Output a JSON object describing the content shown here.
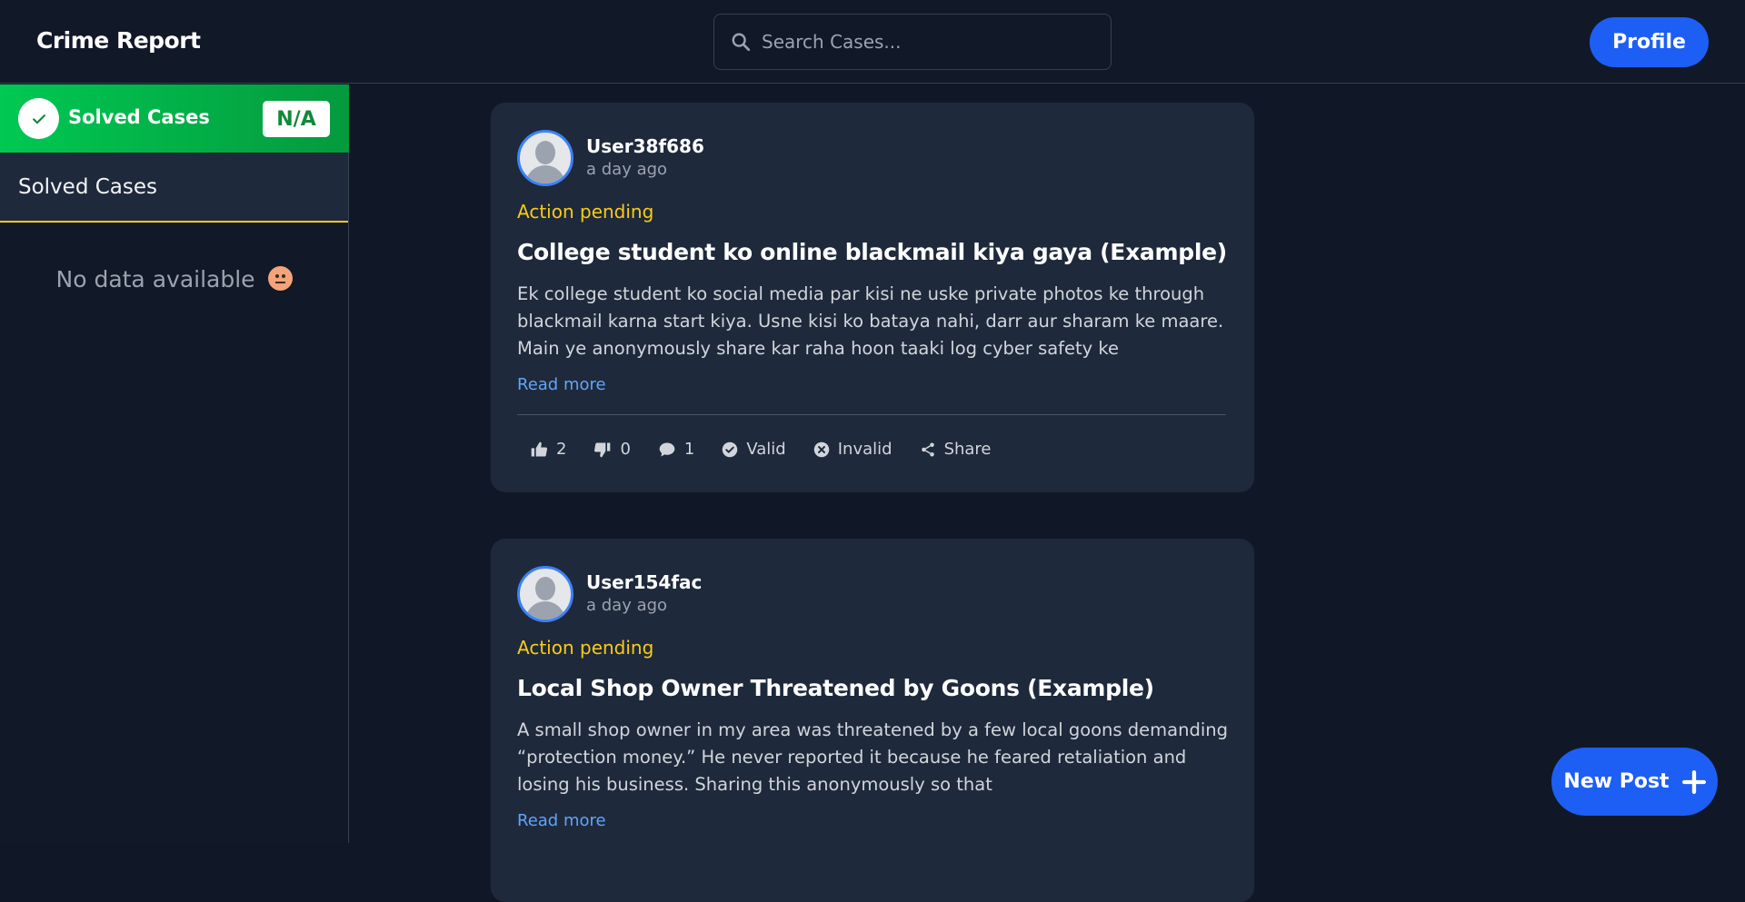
{
  "header": {
    "brand": "Crime Report",
    "search_placeholder": "Search Cases...",
    "profile_label": "Profile"
  },
  "sidebar": {
    "banner_label": "Solved Cases",
    "banner_count": "N/A",
    "tab_label": "Solved Cases",
    "empty_text": "No data available"
  },
  "posts": [
    {
      "username": "User38f686",
      "time": "a day ago",
      "status": "Action pending",
      "title": "College student ko online blackmail kiya gaya (Example)",
      "body": "Ek college student ko social media par kisi ne uske private photos ke through blackmail karna start kiya. Usne kisi ko bataya nahi, darr aur sharam ke maare. Main ye anonymously share kar raha hoon taaki log cyber safety ke",
      "read_more": "Read more",
      "likes": "2",
      "dislikes": "0",
      "comments": "1",
      "valid_label": "Valid",
      "invalid_label": "Invalid",
      "share_label": "Share"
    },
    {
      "username": "User154fac",
      "time": "a day ago",
      "status": "Action pending",
      "title": "Local Shop Owner Threatened by Goons (Example)",
      "body": "A small shop owner in my area was threatened by a few local goons demanding “protection money.” He never reported it because he feared retaliation and losing his business. Sharing this anonymously so that",
      "read_more": "Read more"
    }
  ],
  "fab": {
    "label": "New Post"
  },
  "colors": {
    "accent": "#1d5ef5",
    "success": "#00c853",
    "pending": "#facc15",
    "link": "#60a5fa",
    "card": "#1e293b",
    "background": "#101828"
  }
}
